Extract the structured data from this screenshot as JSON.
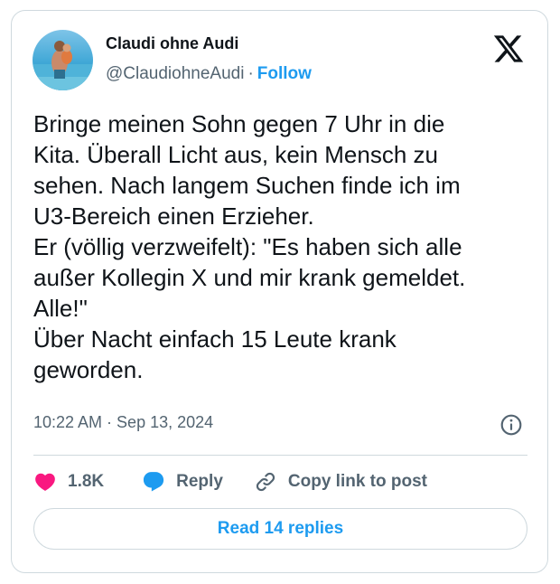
{
  "author": {
    "name": "Claudi ohne Audi",
    "handle": "@ClaudiohneAudi",
    "separator": "·",
    "follow_label": "Follow"
  },
  "tweet": {
    "text": "Bringe meinen Sohn gegen 7 Uhr in die\nKita. Überall Licht aus, kein Mensch zu\nsehen. Nach langem Suchen finde ich im\nU3-Bereich einen Erzieher.\nEr (völlig verzweifelt): \"Es haben sich alle\naußer Kollegin X und mir krank gemeldet.\nAlle!\"\nÜber Nacht einfach 15 Leute krank\ngeworden.",
    "timestamp": "10:22 AM · Sep 13, 2024"
  },
  "actions": {
    "like_count": "1.8K",
    "reply_label": "Reply",
    "copy_link_label": "Copy link to post"
  },
  "replies_button": "Read 14 replies",
  "colors": {
    "accent": "#1d9bf0",
    "heart": "#f91880",
    "text": "#0f1419",
    "muted": "#536471",
    "border": "#cfd9de"
  },
  "icons": [
    "x-logo-icon",
    "info-icon",
    "heart-icon",
    "reply-bubble-icon",
    "link-icon"
  ]
}
